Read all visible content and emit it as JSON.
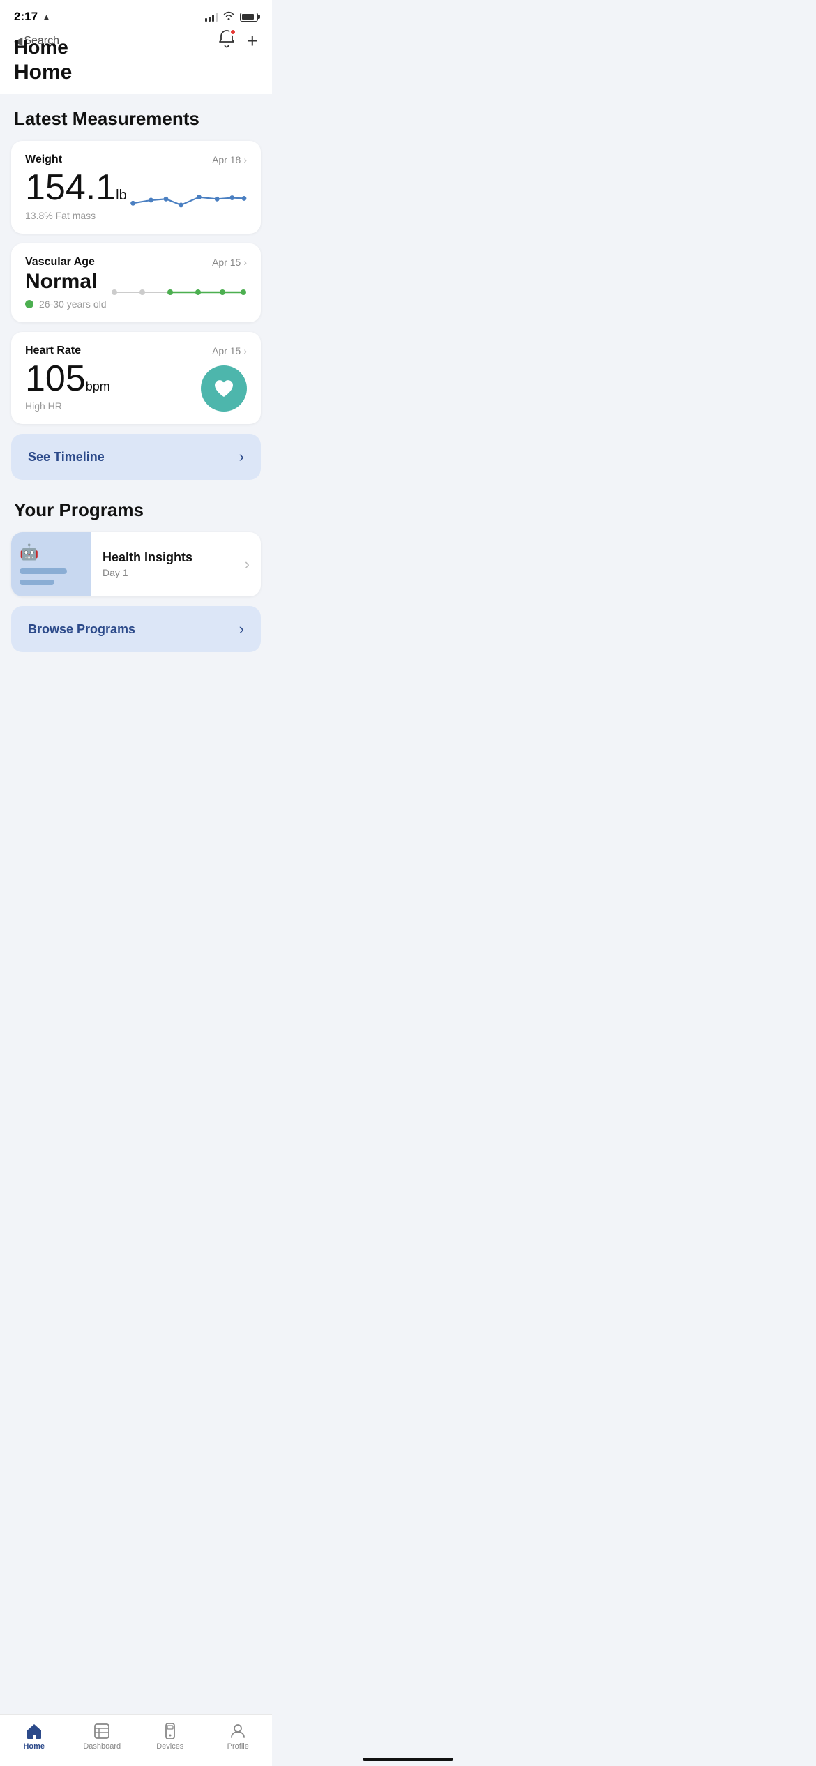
{
  "statusBar": {
    "time": "2:17",
    "locationArrow": "▶",
    "backLabel": "Search"
  },
  "header": {
    "title": "Home",
    "backText": "Search",
    "notifDot": true,
    "addLabel": "+"
  },
  "latestMeasurements": {
    "sectionTitle": "Latest Measurements",
    "cards": [
      {
        "id": "weight",
        "label": "Weight",
        "date": "Apr 18",
        "value": "154.1",
        "unit": "lb",
        "subtitle": "13.8% Fat mass",
        "type": "line-chart"
      },
      {
        "id": "vascular-age",
        "label": "Vascular Age",
        "valueLine1": "Normal",
        "date": "Apr 15",
        "indicator": "green-dot",
        "subtitle": "26-30 years old",
        "type": "vascular-chart"
      },
      {
        "id": "heart-rate",
        "label": "Heart Rate",
        "date": "Apr 15",
        "value": "105",
        "unit": "bpm",
        "subtitle": "High HR",
        "type": "heart-circle"
      }
    ]
  },
  "timeline": {
    "buttonLabel": "See Timeline",
    "buttonArrow": "›"
  },
  "programs": {
    "sectionTitle": "Your Programs",
    "items": [
      {
        "id": "health-insights",
        "name": "Health Insights",
        "day": "Day 1",
        "arrow": "›"
      }
    ],
    "browseLabel": "Browse Programs",
    "browseArrow": "›"
  },
  "tabBar": {
    "tabs": [
      {
        "id": "home",
        "label": "Home",
        "active": true
      },
      {
        "id": "dashboard",
        "label": "Dashboard",
        "active": false
      },
      {
        "id": "devices",
        "label": "Devices",
        "active": false
      },
      {
        "id": "profile",
        "label": "Profile",
        "active": false
      }
    ]
  },
  "colors": {
    "accent": "#2c4a8a",
    "accentLight": "#dce6f7",
    "green": "#4caf50",
    "teal": "#4db6ac",
    "chartBlue": "#4a7fc1",
    "vascularGreen": "#4caf50",
    "cardBg": "#ffffff",
    "pageBg": "#f2f4f8"
  }
}
